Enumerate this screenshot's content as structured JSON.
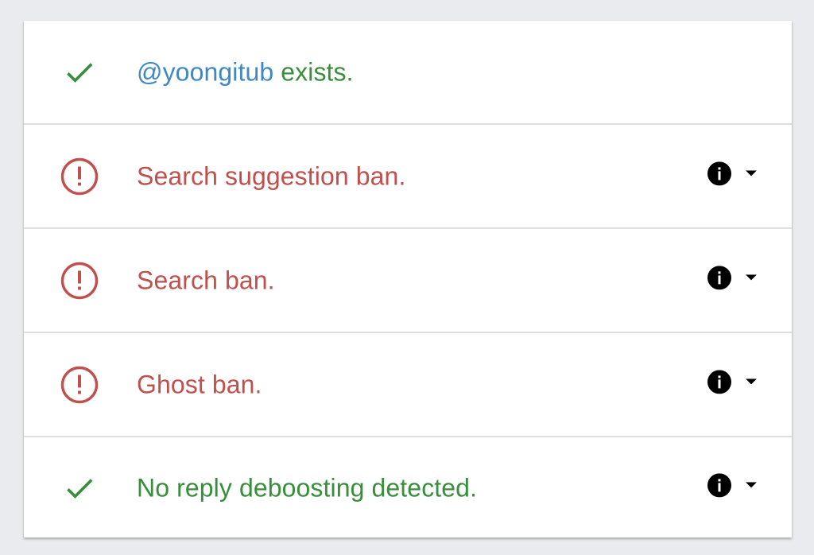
{
  "colors": {
    "success": "#388e3c",
    "error": "#c0504d",
    "handle": "#3f88c5",
    "background": "#e9ebee",
    "card": "#ffffff",
    "divider": "#dedede"
  },
  "results": [
    {
      "status": "pass",
      "status_icon": "check-icon",
      "handle": "@yoongitub",
      "text": " exists.",
      "has_details": false
    },
    {
      "status": "fail",
      "status_icon": "alert-circle-icon",
      "text": "Search suggestion ban.",
      "has_details": true,
      "details_icons": [
        "info-icon",
        "caret-down-icon"
      ]
    },
    {
      "status": "fail",
      "status_icon": "alert-circle-icon",
      "text": "Search ban.",
      "has_details": true,
      "details_icons": [
        "info-icon",
        "caret-down-icon"
      ]
    },
    {
      "status": "fail",
      "status_icon": "alert-circle-icon",
      "text": "Ghost ban.",
      "has_details": true,
      "details_icons": [
        "info-icon",
        "caret-down-icon"
      ]
    },
    {
      "status": "pass",
      "status_icon": "check-icon",
      "text": "No reply deboosting detected.",
      "has_details": true,
      "details_icons": [
        "info-icon",
        "caret-down-icon"
      ]
    }
  ]
}
